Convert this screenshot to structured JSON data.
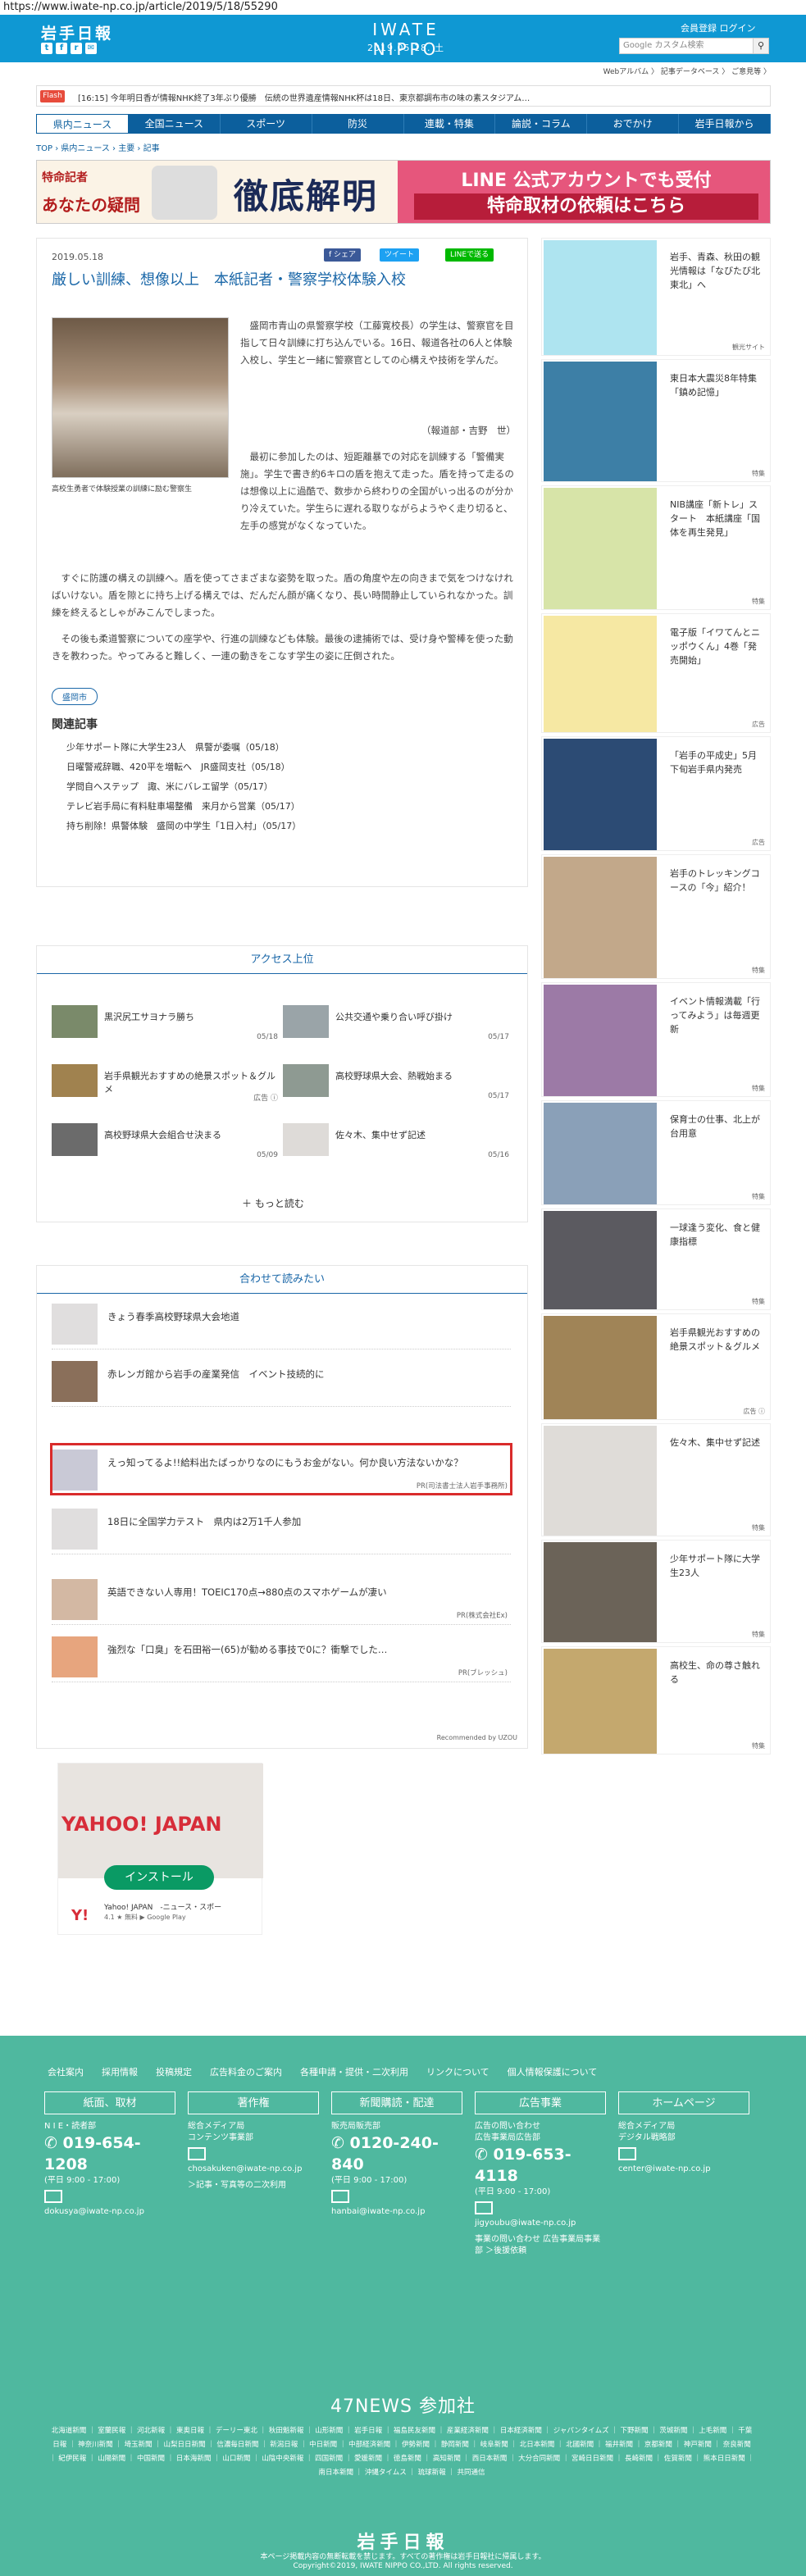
{
  "url": "https://www.iwate-np.co.jp/article/2019/5/18/55290",
  "header": {
    "logo_jp": "岩手日報",
    "logo_en": "IWATE NIPPO",
    "date": "2019.05.18. 土",
    "account": "会員登録 ログイン",
    "search_placeholder": "Google カスタム検索",
    "sublinks": "Webアルバム 〉 記事データベース 〉 ご意見等 〉"
  },
  "flash": {
    "label": "Flash",
    "text": "[16:15] 今年明日香が情報NHK終了3年ぶり優勝　伝統の世界遺産情報NHK杯は18日、東京都調布市の味の素スタジアム…"
  },
  "nav": [
    "県内ニュース",
    "全国ニュース",
    "スポーツ",
    "防災",
    "連載・特集",
    "論説・コラム",
    "おでかけ",
    "岩手日報から"
  ],
  "crumb": "TOP › 県内ニュース › 主要 › 記事",
  "banner": {
    "left_small": "特命記者",
    "left_title": "あなたの疑問",
    "left_big": "徹底解明",
    "right_l1": "LINE 公式アカウントでも受付",
    "right_l2": "特命取材の依頼はこちら"
  },
  "article": {
    "date": "2019.05.18",
    "share": [
      "f シェア",
      "ツイート",
      "LINEで送る"
    ],
    "title": "厳しい訓練、想像以上　本紙記者・警察学校体験入校",
    "caption": "高校生勇者で体験授業の訓練に励む警察生",
    "p1": "　盛岡市青山の県警察学校（工藤寛校長）の学生は、警察官を目指して日々訓練に打ち込んでいる。16日、報道各社の6人と体験入校し、学生と一緒に警察官としての心構えや技術を学んだ。",
    "p1b": "（報道部・吉野　世）",
    "p2": "　最初に参加したのは、短距離暴での対応を訓練する「警備実施」。学生で書き約6キロの盾を抱えて走った。盾を持って走るのは想像以上に過酷で、数歩から終わりの全国がいっ出るのが分かり冷えていた。学生らに遅れる取りながらようやく走り切ると、左手の感覚がなくなっていた。",
    "p3": "　すぐに防護の構えの訓練へ。盾を使ってさまざまな姿勢を取った。盾の角度や左の向きまで気をつけなければいけない。盾を隙とに持ち上げる構えでは、だんだん顔が痛くなり、長い時間静止していられなかった。訓練を終えるとしゃがみこんでしまった。",
    "p4": "　その後も柔道警察についての座学や、行進の訓練なども体験。最後の逮捕術では、受け身や警棒を使った動きを教わった。やってみると難しく、一連の動きをこなす学生の姿に圧倒された。",
    "tag": "盛岡市",
    "related_head": "関連記事",
    "related": [
      "少年サポート隊に大学生23人　県警が委嘱（05/18）",
      "日曜警戒辞職、420平を増転へ　JR盛岡支社（05/18）",
      "学問自へステップ　諏、米にバレエ留学（05/17）",
      "テレビ岩手局に有料駐車場整備　来月から営業（05/17）",
      "持ち削除！県警体験　盛岡の中学生「1日入村」（05/17）"
    ]
  },
  "access": {
    "head": "アクセス上位",
    "items": [
      {
        "t": "黒沢尻工サヨナラ勝ち",
        "d": "05/18"
      },
      {
        "t": "公共交通や乗り合い呼び掛け",
        "d": "05/17"
      },
      {
        "t": "岩手県観光おすすめの絶景スポット＆グルメ",
        "d": "広告 ⓘ"
      },
      {
        "t": "高校野球県大会、熱戦始まる",
        "d": "05/17"
      },
      {
        "t": "高校野球県大会組合せ決まる",
        "d": "05/09"
      },
      {
        "t": "佐々木、集中せず記述",
        "d": "05/16"
      }
    ],
    "more": "もっと読む"
  },
  "recommend": {
    "head": "合わせて読みたい",
    "items": [
      {
        "t": "きょう春季高校野球県大会地道",
        "pr": ""
      },
      {
        "t": "赤レンガ館から岩手の産業発信　イベント技続的に",
        "pr": ""
      },
      {
        "t": "えっ知ってるよ!!給料出たばっかりなのにもうお金がない。何か良い方法ないかな？",
        "pr": "PR(司法書士法人岩手事務所)"
      },
      {
        "t": "18日に全国学力テスト　県内は2万1千人参加",
        "pr": ""
      },
      {
        "t": "英語できない人専用！TOEIC170点→880点のスマホゲームが凄い",
        "pr": "PR(株式会社Ex)"
      },
      {
        "t": "強烈な「口臭」を石田裕一(65)が勧める事技で0に？衝撃でした…",
        "pr": "PR(ブレッシュ)"
      }
    ],
    "foot": "Recommended by UZOU"
  },
  "yahoo": {
    "logo": "YAHOO! JAPAN",
    "install": "インストール",
    "title": "Yahoo! JAPAN　-ニュース・スポー",
    "rating": "4.1 ★ 無料 ▶ Google Play"
  },
  "sidebar": [
    {
      "t": "岩手、青森、秋田の観光情報は「なびたび北東北」へ",
      "b": "観光サイト",
      "h": 144,
      "c": "#aee4f0"
    },
    {
      "t": "東日本大震災8年特集「鎮め記憶」",
      "b": "特集",
      "h": 150,
      "c": "#3d7fa6"
    },
    {
      "t": "NIB講座「新トレ」スタート　本紙講座「国体を再生発見」",
      "b": "特集",
      "h": 152,
      "c": "#d7e4a8"
    },
    {
      "t": "電子版「イワてんとニッポウくん」4巻「発売開始」",
      "b": "広告",
      "h": 146,
      "c": "#f6e8a3"
    },
    {
      "t": "「岩手の平成史」5月下旬岩手県内発売",
      "b": "広告",
      "h": 140,
      "c": "#2c4b74"
    },
    {
      "t": "岩手のトレッキングコースの「今」紹介！",
      "b": "特集",
      "h": 152,
      "c": "#c2a88a"
    },
    {
      "t": "イベント情報満載「行ってみよう」は毎週更新",
      "b": "特集",
      "h": 140,
      "c": "#9c7aa6"
    },
    {
      "t": "保育士の仕事、北上が台用意",
      "b": "特集",
      "h": 128,
      "c": "#8aa0b8"
    },
    {
      "t": "一球逢う変化、食と健康指標",
      "b": "特集",
      "h": 124,
      "c": "#5b5a60"
    },
    {
      "t": "岩手県観光おすすめの絶景スポット＆グルメ",
      "b": "広告 ⓘ",
      "h": 130,
      "c": "#a08457"
    },
    {
      "t": "佐々木、集中せず記述",
      "b": "特集",
      "h": 138,
      "c": "#dfdcd8"
    },
    {
      "t": "少年サポート隊に大学生23人",
      "b": "特集",
      "h": 126,
      "c": "#6b6358"
    },
    {
      "t": "高校生、命の尊さ触れる",
      "b": "特集",
      "h": 132,
      "c": "#c4a86e"
    }
  ],
  "footer": {
    "links": "会社案内　　採用情報　　投稿規定　　広告料金のご案内　　各種申請・提供・二次利用　　リンクについて　　個人情報保護について",
    "boxes": [
      {
        "hd": "紙面、取材",
        "body": [
          "N I E・読者部"
        ],
        "phone": "019-654-1208",
        "hours": "(平日 9:00 - 17:00)",
        "mail": "dokusya@iwate-np.co.jp",
        "extra": ""
      },
      {
        "hd": "著作権",
        "body": [
          "総合メディア局",
          "コンテンツ事業部"
        ],
        "phone": "",
        "hours": "",
        "mail": "chosakuken@iwate-np.co.jp",
        "extra": "＞記事・写真等の二次利用"
      },
      {
        "hd": "新聞購読・配達",
        "body": [
          "販売局販売部"
        ],
        "phone": "0120-240-840",
        "hours": "(平日 9:00 - 17:00)",
        "mail": "hanbai@iwate-np.co.jp",
        "extra": ""
      },
      {
        "hd": "広告事業",
        "body": [
          "広告の問い合わせ",
          "広告事業局広告部"
        ],
        "phone": "019-653-4118",
        "hours": "(平日 9:00 - 17:00)",
        "mail": "jigyoubu@iwate-np.co.jp",
        "extra": "事業の問い合わせ 広告事業局事業部 ＞後援依頼"
      },
      {
        "hd": "ホームページ",
        "body": [
          "総合メディア局",
          "デジタル戦略部"
        ],
        "phone": "",
        "hours": "",
        "mail": "center@iwate-np.co.jp",
        "extra": ""
      }
    ],
    "news47": "47NEWS 参加社",
    "papers": "北海道新聞 ｜ 室蘭民報 ｜ 河北新報 ｜ 東奥日報 ｜ デーリー東北 ｜ 秋田魁新報 ｜ 山形新聞 ｜ 岩手日報 ｜ 福島民友新聞 ｜ 産業経済新聞 ｜ 日本経済新聞 ｜ ジャパンタイムズ ｜ 下野新聞 ｜ 茨城新聞 ｜ 上毛新聞 ｜ 千葉日報 ｜ 神奈川新聞 ｜ 埼玉新聞 ｜ 山梨日日新聞 ｜ 信濃毎日新聞 ｜ 新潟日報 ｜ 中日新聞 ｜ 中部経済新聞 ｜ 伊勢新聞 ｜ 静岡新聞 ｜ 岐阜新聞 ｜ 北日本新聞 ｜ 北國新聞 ｜ 福井新聞 ｜ 京都新聞 ｜ 神戸新聞 ｜ 奈良新聞 ｜ 紀伊民報 ｜ 山陽新聞 ｜ 中国新聞 ｜ 日本海新聞 ｜ 山口新聞 ｜ 山陰中央新報 ｜ 四国新聞 ｜ 愛媛新聞 ｜ 徳島新聞 ｜ 高知新聞 ｜ 西日本新聞 ｜ 大分合同新聞 ｜ 宮崎日日新聞 ｜ 長崎新聞 ｜ 佐賀新聞 ｜ 熊本日日新聞 ｜ 南日本新聞 ｜ 沖縄タイムス ｜ 琉球新報 ｜ 共同通信",
    "logo": "岩手日報",
    "copy1": "本ページ掲載内容の無断転載を禁じます。すべての著作権は岩手日報社に帰属します。",
    "copy2": "Copyright©2019, IWATE NIPPO CO.,LTD. All rights reserved."
  },
  "colors": {
    "brand": "#0f98d3",
    "nav": "#0c5f9d",
    "footer": "#4fb89f",
    "highlight": "#d92b2b"
  }
}
